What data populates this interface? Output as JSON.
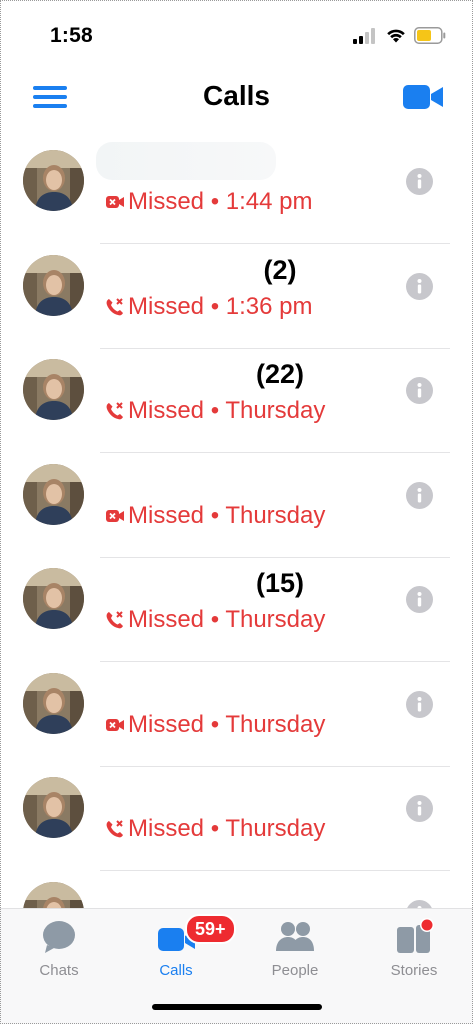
{
  "status_bar": {
    "time": "1:58"
  },
  "header": {
    "title": "Calls"
  },
  "colors": {
    "accent": "#1a7ff0",
    "missed": "#e43a3a",
    "badge": "#ee2b30",
    "info": "#c7c7cc",
    "inactive_tab": "#8e8e93"
  },
  "calls": [
    {
      "name": "",
      "call_type": "video-missed-icon",
      "status": "Missed • 1:44 pm"
    },
    {
      "name": "(2)",
      "call_type": "phone-missed-icon",
      "status": "Missed • 1:36 pm"
    },
    {
      "name": "(22)",
      "call_type": "phone-missed-icon",
      "status": "Missed • Thursday"
    },
    {
      "name": "",
      "call_type": "video-missed-icon",
      "status": "Missed • Thursday"
    },
    {
      "name": "(15)",
      "call_type": "phone-missed-icon",
      "status": "Missed • Thursday"
    },
    {
      "name": "",
      "call_type": "video-missed-icon",
      "status": "Missed • Thursday"
    },
    {
      "name": "",
      "call_type": "phone-missed-icon",
      "status": "Missed • Thursday"
    },
    {
      "name": "",
      "call_type": "",
      "status": ""
    }
  ],
  "tabs": {
    "chats": {
      "label": "Chats",
      "icon": "chat-bubble-icon"
    },
    "calls": {
      "label": "Calls",
      "icon": "video-call-icon",
      "badge": "59+"
    },
    "people": {
      "label": "People",
      "icon": "people-icon"
    },
    "stories": {
      "label": "Stories",
      "icon": "stories-icon"
    }
  }
}
